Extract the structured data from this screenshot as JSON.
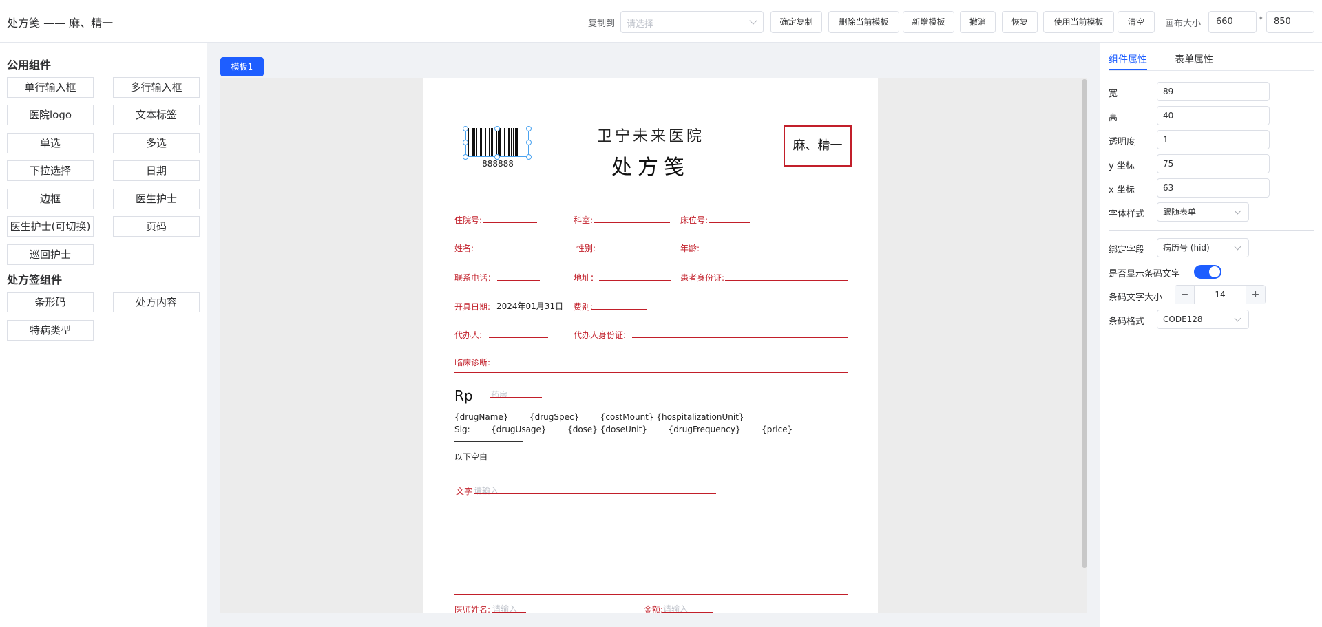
{
  "header": {
    "title": "处方笺 —— 麻、精一",
    "copy_label": "复制到",
    "copy_placeholder": "请选择",
    "buttons": {
      "confirm_copy": "确定复制",
      "delete_template": "删除当前模板",
      "add_template": "新增模板",
      "undo": "撤消",
      "redo": "恢复",
      "use_template": "使用当前模板",
      "clear": "清空"
    },
    "canvas_size_label": "画布大小",
    "canvas_width": "660",
    "times": "*",
    "canvas_height": "850"
  },
  "left_panel": {
    "public_title": "公用组件",
    "public_items": [
      "单行输入框",
      "多行输入框",
      "医院logo",
      "文本标签",
      "单选",
      "多选",
      "下拉选择",
      "日期",
      "边框",
      "医生护士",
      "医生护士(可切换)",
      "页码",
      "巡回护士"
    ],
    "rx_title": "处方签组件",
    "rx_items": [
      "条形码",
      "处方内容",
      "特病类型"
    ]
  },
  "center": {
    "template_tab": "模板1",
    "paper": {
      "hospital_name": "卫宁未来医院",
      "rx_title": "处方笺",
      "stamp": "麻、精一",
      "barcode_text": "888888",
      "fields": {
        "admission_no": "住院号:",
        "department": "科室:",
        "bed_no": "床位号:",
        "name": "姓名:",
        "gender": "性别:",
        "age": "年龄:",
        "phone": "联系电话：",
        "address": "地址：",
        "patient_id": "患者身份证:",
        "issue_date_label": "开具日期:",
        "issue_date_value": "2024年01月31日",
        "fee_type": "费别:",
        "agent": "代办人:",
        "agent_id": "代办人身份证:",
        "diagnosis": "临床诊断:"
      },
      "rp": "Rp",
      "pharmacy_placeholder": "药房",
      "rx_line1": "{drugName}        {drugSpec}        {costMount} {hospitalizationUnit}",
      "rx_line2": "Sig:        {drugUsage}        {dose} {doseUnit}        {drugFrequency}        {price}",
      "blank_below": "以下空白",
      "text_label": "文字",
      "text_placeholder": "请输入",
      "doctor_label": "医师姓名:",
      "doctor_placeholder": "请输入",
      "amount_label": "金额:",
      "amount_placeholder": "请输入"
    }
  },
  "right_panel": {
    "tab_component": "组件属性",
    "tab_form": "表单属性",
    "width_label": "宽",
    "width_value": "89",
    "height_label": "高",
    "height_value": "40",
    "opacity_label": "透明度",
    "opacity_value": "1",
    "y_label": "y 坐标",
    "y_value": "75",
    "x_label": "x 坐标",
    "x_value": "63",
    "font_style_label": "字体样式",
    "font_style_value": "跟随表单",
    "bind_field_label": "绑定字段",
    "bind_field_value": "病历号 (hid)",
    "show_barcode_text_label": "是否显示条码文字",
    "show_barcode_text": true,
    "barcode_font_size_label": "条码文字大小",
    "barcode_font_size_value": "14",
    "minus": "−",
    "plus": "+",
    "barcode_format_label": "条码格式",
    "barcode_format_value": "CODE128"
  },
  "colors": {
    "accent": "#1e5eff",
    "form_red": "#c21f2a",
    "panel_bg": "#f0f2f5"
  }
}
